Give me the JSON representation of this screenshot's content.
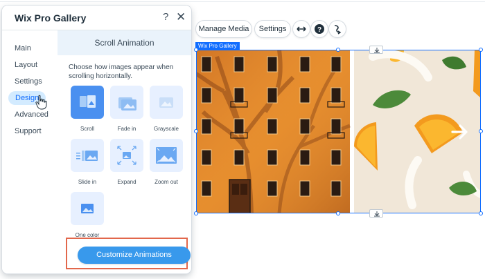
{
  "panel": {
    "title": "Wix Pro Gallery",
    "help_label": "?",
    "close_label": "✕",
    "nav": [
      {
        "label": "Main"
      },
      {
        "label": "Layout"
      },
      {
        "label": "Settings"
      },
      {
        "label": "Design",
        "active": true
      },
      {
        "label": "Advanced"
      },
      {
        "label": "Support"
      }
    ],
    "section_title": "Scroll Animation",
    "section_description": "Choose how images appear when scrolling horizontally.",
    "animations": [
      {
        "label": "Scroll",
        "icon": "scroll-animation-icon",
        "selected": true
      },
      {
        "label": "Fade in",
        "icon": "fade-in-animation-icon"
      },
      {
        "label": "Grayscale",
        "icon": "grayscale-animation-icon"
      },
      {
        "label": "Slide in",
        "icon": "slide-in-animation-icon"
      },
      {
        "label": "Expand",
        "icon": "expand-animation-icon"
      },
      {
        "label": "Zoom out",
        "icon": "zoom-out-animation-icon"
      },
      {
        "label": "One color",
        "icon": "one-color-animation-icon"
      }
    ],
    "cta_label": "Customize Animations"
  },
  "toolbar": {
    "manage_media_label": "Manage Media",
    "settings_label": "Settings",
    "stretch_icon": "stretch-arrows-icon",
    "help_icon": "help-circle-icon",
    "animation_icon": "animation-icon"
  },
  "gallery": {
    "tag_label": "Wix Pro Gallery",
    "next_icon": "arrow-right-icon",
    "download_icon": "download-icon",
    "colors": {
      "selection": "#116dff",
      "accent_button": "#3899ec",
      "highlight_frame": "#e2674b",
      "building_orange": "#e58a2a",
      "background_cream": "#f1e7d8"
    }
  }
}
